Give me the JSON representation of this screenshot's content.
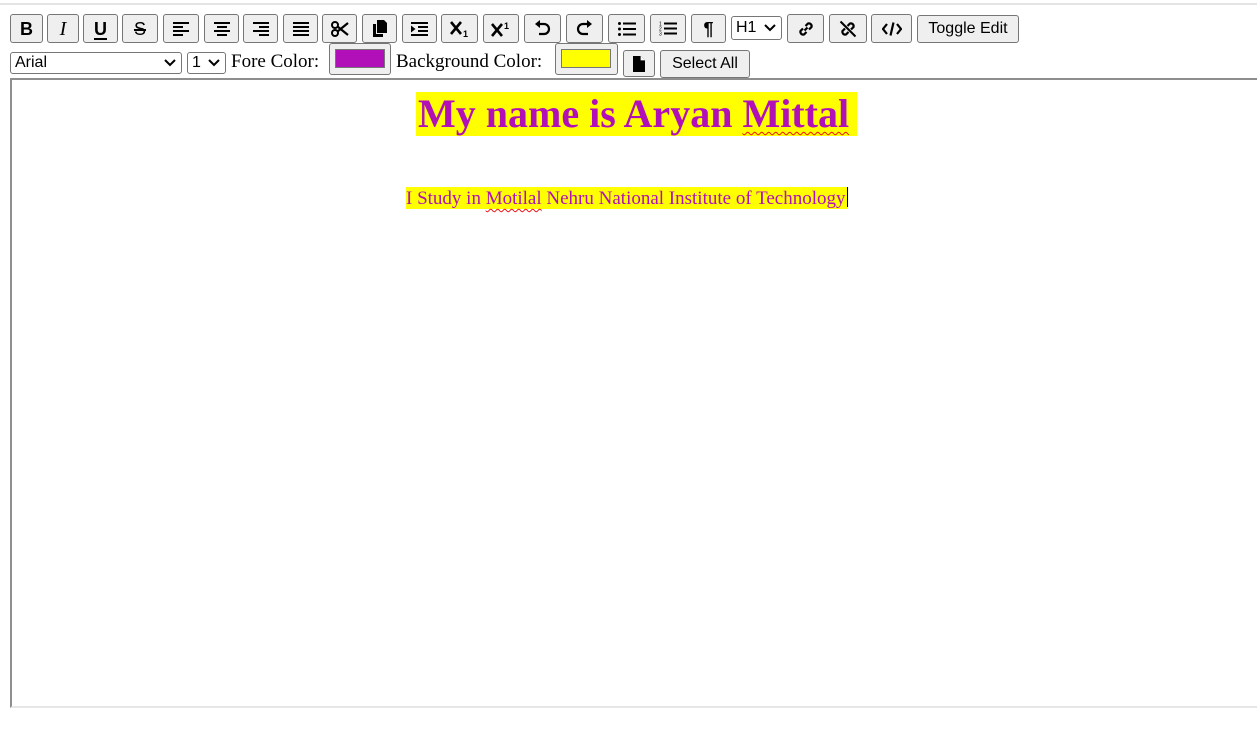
{
  "toolbar": {
    "buttons": [
      {
        "name": "bold",
        "icon": "bold-icon",
        "glyph": "B"
      },
      {
        "name": "italic",
        "icon": "italic-icon",
        "glyph": "I"
      },
      {
        "name": "underline",
        "icon": "underline-icon",
        "glyph": "U"
      },
      {
        "name": "strikethrough",
        "icon": "strikethrough-icon",
        "glyph": "S"
      },
      {
        "name": "align-left",
        "icon": "align-left-icon"
      },
      {
        "name": "align-center",
        "icon": "align-center-icon"
      },
      {
        "name": "align-right",
        "icon": "align-right-icon"
      },
      {
        "name": "justify",
        "icon": "align-justify-icon"
      },
      {
        "name": "cut",
        "icon": "scissors-icon"
      },
      {
        "name": "copy",
        "icon": "copy-icon"
      },
      {
        "name": "indent",
        "icon": "indent-icon"
      },
      {
        "name": "subscript",
        "icon": "subscript-icon"
      },
      {
        "name": "superscript",
        "icon": "superscript-icon"
      },
      {
        "name": "undo",
        "icon": "undo-icon"
      },
      {
        "name": "redo",
        "icon": "redo-icon"
      },
      {
        "name": "unordered-list",
        "icon": "bullet-list-icon"
      },
      {
        "name": "ordered-list",
        "icon": "numbered-list-icon"
      },
      {
        "name": "paragraph",
        "icon": "pilcrow-icon",
        "glyph": "¶"
      }
    ],
    "heading_select": {
      "value": "H1"
    },
    "link_button": {
      "icon": "link-icon"
    },
    "unlink_button": {
      "icon": "unlink-icon"
    },
    "code_button": {
      "icon": "code-icon"
    },
    "toggle_edit_label": "Toggle Edit"
  },
  "toolbar2": {
    "font_select": {
      "value": "Arial"
    },
    "size_select": {
      "value": "1"
    },
    "fore_color_label": "Fore Color:",
    "fore_color_value": "#b10fb8",
    "bg_color_label": "Background Color:",
    "bg_color_value": "#ffff00",
    "new_doc_icon": "file-icon",
    "select_all_label": "Select All"
  },
  "editor": {
    "heading_parts": [
      "My name is Aryan ",
      "Mittal"
    ],
    "paragraph_parts": [
      "I Study in ",
      "Motilal",
      " Nehru National Institute of Technology"
    ]
  }
}
